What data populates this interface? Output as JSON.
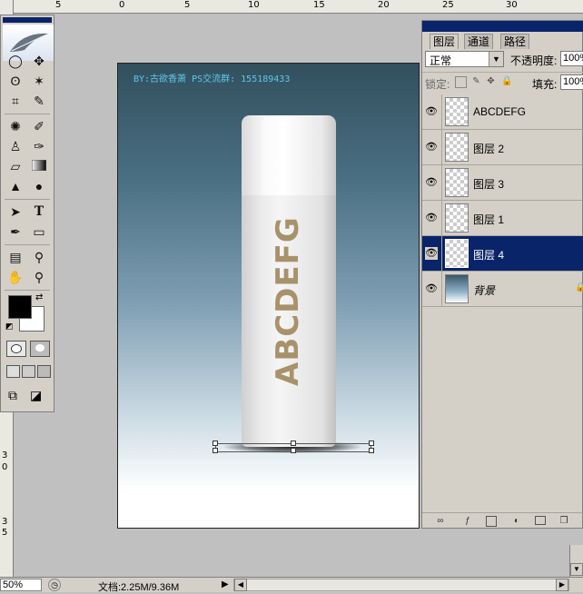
{
  "rulers": {
    "top_labels": [
      "5",
      "0",
      "5",
      "10",
      "15",
      "20",
      "25",
      "30"
    ],
    "left_labels": [
      "3",
      "0",
      "3",
      "5"
    ]
  },
  "toolbox": {
    "tools": [
      "marquee-tool",
      "move-tool",
      "lasso-tool",
      "magic-wand-tool",
      "crop-tool",
      "slice-tool",
      "healing-brush-tool",
      "brush-tool",
      "clone-stamp-tool",
      "history-brush-tool",
      "eraser-tool",
      "gradient-tool",
      "blur-tool",
      "dodge-tool",
      "path-select-tool",
      "type-tool",
      "pen-tool",
      "shape-tool",
      "notes-tool",
      "eyedropper-tool",
      "hand-tool",
      "zoom-tool"
    ],
    "type_glyph": "T",
    "colors": {
      "foreground": "#000000",
      "background": "#ffffff"
    }
  },
  "canvas": {
    "watermark": "BY:古欲香萧 PS交流群: 155189433",
    "bottle_text": "ABCDEFG",
    "colors": {
      "top": "#32505e",
      "bottom": "#ffffff",
      "text": "#a8926a"
    }
  },
  "layers_panel": {
    "tabs": [
      "图层",
      "通道",
      "路径"
    ],
    "blend_mode": "正常",
    "opacity_label": "不透明度:",
    "opacity_value": "100%",
    "lock_label": "锁定:",
    "fill_label": "填充:",
    "fill_value": "100%",
    "layers": [
      {
        "name": "ABCDEFG",
        "visible": true,
        "selected": false
      },
      {
        "name": "图层 2",
        "visible": true,
        "selected": false
      },
      {
        "name": "图层 3",
        "visible": true,
        "selected": false
      },
      {
        "name": "图层 1",
        "visible": true,
        "selected": false
      },
      {
        "name": "图层 4",
        "visible": true,
        "selected": true
      },
      {
        "name": "背景",
        "visible": true,
        "selected": false,
        "locked": true
      }
    ]
  },
  "statusbar": {
    "zoom": "50%",
    "doc_info": "文档:2.25M/9.36M"
  }
}
